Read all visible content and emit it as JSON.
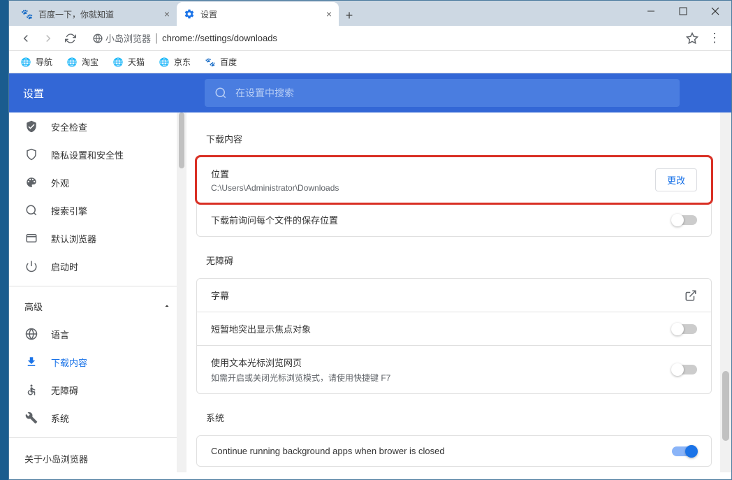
{
  "tabs": [
    {
      "title": "百度一下，你就知道",
      "active": false
    },
    {
      "title": "设置",
      "active": true
    }
  ],
  "url": {
    "host": "小岛浏览器",
    "path": "chrome://settings/downloads"
  },
  "bookmarks": [
    "导航",
    "淘宝",
    "天猫",
    "京东",
    "百度"
  ],
  "header": {
    "title": "设置",
    "search_placeholder": "在设置中搜索"
  },
  "sidebar": {
    "items": [
      {
        "label": "安全检查"
      },
      {
        "label": "隐私设置和安全性"
      },
      {
        "label": "外观"
      },
      {
        "label": "搜索引擎"
      },
      {
        "label": "默认浏览器"
      },
      {
        "label": "启动时"
      }
    ],
    "advanced_label": "高级",
    "adv_items": [
      {
        "label": "语言"
      },
      {
        "label": "下载内容",
        "active": true
      },
      {
        "label": "无障碍"
      },
      {
        "label": "系统"
      }
    ],
    "footer": "关于小岛浏览器"
  },
  "sections": {
    "downloads": {
      "title": "下载内容",
      "location_label": "位置",
      "location_path": "C:\\Users\\Administrator\\Downloads",
      "change_btn": "更改",
      "ask_label": "下载前询问每个文件的保存位置"
    },
    "accessibility": {
      "title": "无障碍",
      "captions": "字幕",
      "focus": "短暂地突出显示焦点对象",
      "caret_title": "使用文本光标浏览网页",
      "caret_sub": "如需开启或关闭光标浏览模式，请使用快捷键 F7"
    },
    "system": {
      "title": "系统",
      "bg_apps": "Continue running background apps when brower is closed"
    }
  }
}
